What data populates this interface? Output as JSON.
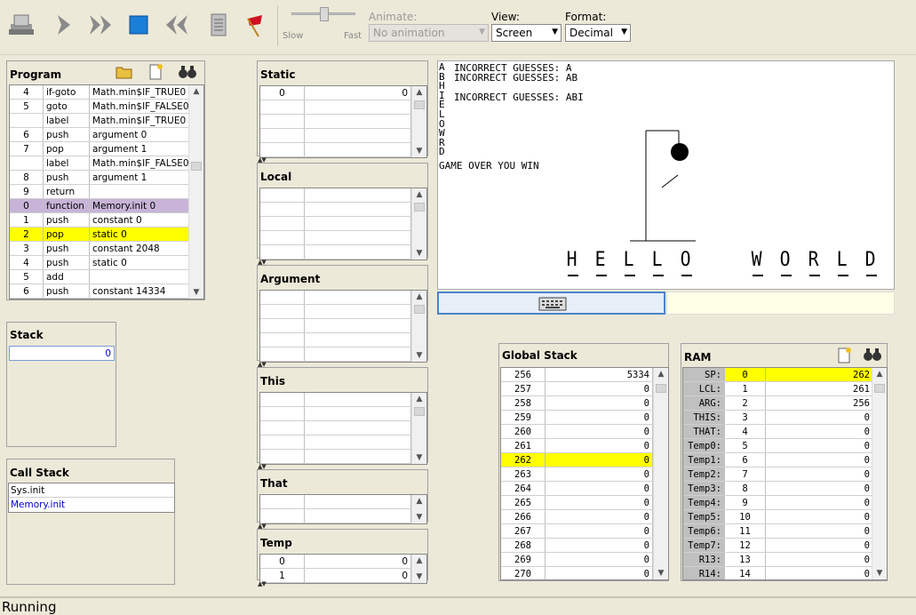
{
  "toolbar": {
    "buttons": [
      "load-icon",
      "step-icon",
      "fast-forward-icon",
      "stop-icon",
      "rewind-icon",
      "script-icon",
      "breakpoint-icon"
    ],
    "slow_label": "Slow",
    "fast_label": "Fast",
    "animate_label": "Animate:",
    "animate_value": "No animation",
    "view_label": "View:",
    "view_value": "Screen",
    "format_label": "Format:",
    "format_value": "Decimal"
  },
  "program": {
    "title": "Program",
    "rows": [
      {
        "n": "4",
        "cmd": "if-goto",
        "arg": "Math.min$IF_TRUE0"
      },
      {
        "n": "5",
        "cmd": "goto",
        "arg": "Math.min$IF_FALSE0"
      },
      {
        "n": "",
        "cmd": "label",
        "arg": "Math.min$IF_TRUE0"
      },
      {
        "n": "6",
        "cmd": "push",
        "arg": "argument 0"
      },
      {
        "n": "7",
        "cmd": "pop",
        "arg": "argument 1"
      },
      {
        "n": "",
        "cmd": "label",
        "arg": "Math.min$IF_FALSE0"
      },
      {
        "n": "8",
        "cmd": "push",
        "arg": "argument 1"
      },
      {
        "n": "9",
        "cmd": "return",
        "arg": ""
      },
      {
        "n": "0",
        "cmd": "function",
        "arg": "Memory.init 0"
      },
      {
        "n": "1",
        "cmd": "push",
        "arg": "constant 0"
      },
      {
        "n": "2",
        "cmd": "pop",
        "arg": "static 0"
      },
      {
        "n": "3",
        "cmd": "push",
        "arg": "constant 2048"
      },
      {
        "n": "4",
        "cmd": "push",
        "arg": "static 0"
      },
      {
        "n": "5",
        "cmd": "add",
        "arg": ""
      },
      {
        "n": "6",
        "cmd": "push",
        "arg": "constant 14334"
      }
    ]
  },
  "stack": {
    "title": "Stack",
    "rows": [
      "0"
    ]
  },
  "call_stack": {
    "title": "Call Stack",
    "rows": [
      "Sys.init",
      "Memory.init"
    ]
  },
  "segments": {
    "static": {
      "title": "Static",
      "rows": [
        [
          "0",
          "0"
        ]
      ]
    },
    "local": {
      "title": "Local"
    },
    "argument": {
      "title": "Argument"
    },
    "this": {
      "title": "This"
    },
    "that": {
      "title": "That"
    },
    "temp": {
      "title": "Temp",
      "rows": [
        [
          "0",
          "0"
        ],
        [
          "1",
          "0"
        ]
      ]
    }
  },
  "screen": {
    "side_letters": "A\nB\nH\nI\nE\nL\nO\nW\nR\nD",
    "lines": [
      "INCORRECT GUESSES: A",
      "INCORRECT GUESSES: AB",
      "",
      "INCORRECT GUESSES: ABI"
    ],
    "game_over": "GAME OVER YOU WIN",
    "word1": [
      "H",
      "E",
      "L",
      "L",
      "O"
    ],
    "word2": [
      "W",
      "O",
      "R",
      "L",
      "D"
    ]
  },
  "global_stack": {
    "title": "Global Stack",
    "rows": [
      [
        "256",
        "5334"
      ],
      [
        "257",
        "0"
      ],
      [
        "258",
        "0"
      ],
      [
        "259",
        "0"
      ],
      [
        "260",
        "0"
      ],
      [
        "261",
        "0"
      ],
      [
        "262",
        "0"
      ],
      [
        "263",
        "0"
      ],
      [
        "264",
        "0"
      ],
      [
        "265",
        "0"
      ],
      [
        "266",
        "0"
      ],
      [
        "267",
        "0"
      ],
      [
        "268",
        "0"
      ],
      [
        "269",
        "0"
      ],
      [
        "270",
        "0"
      ]
    ]
  },
  "ram": {
    "title": "RAM",
    "rows": [
      [
        "SP:",
        "0",
        "262"
      ],
      [
        "LCL:",
        "1",
        "261"
      ],
      [
        "ARG:",
        "2",
        "256"
      ],
      [
        "THIS:",
        "3",
        "0"
      ],
      [
        "THAT:",
        "4",
        "0"
      ],
      [
        "Temp0:",
        "5",
        "0"
      ],
      [
        "Temp1:",
        "6",
        "0"
      ],
      [
        "Temp2:",
        "7",
        "0"
      ],
      [
        "Temp3:",
        "8",
        "0"
      ],
      [
        "Temp4:",
        "9",
        "0"
      ],
      [
        "Temp5:",
        "10",
        "0"
      ],
      [
        "Temp6:",
        "11",
        "0"
      ],
      [
        "Temp7:",
        "12",
        "0"
      ],
      [
        "R13:",
        "13",
        "0"
      ],
      [
        "R14:",
        "14",
        "0"
      ]
    ]
  },
  "status": {
    "text": "Running"
  },
  "colors": {
    "highlight": "#ffff00",
    "selected": "#c7b4d8",
    "link": "#0000cc"
  }
}
